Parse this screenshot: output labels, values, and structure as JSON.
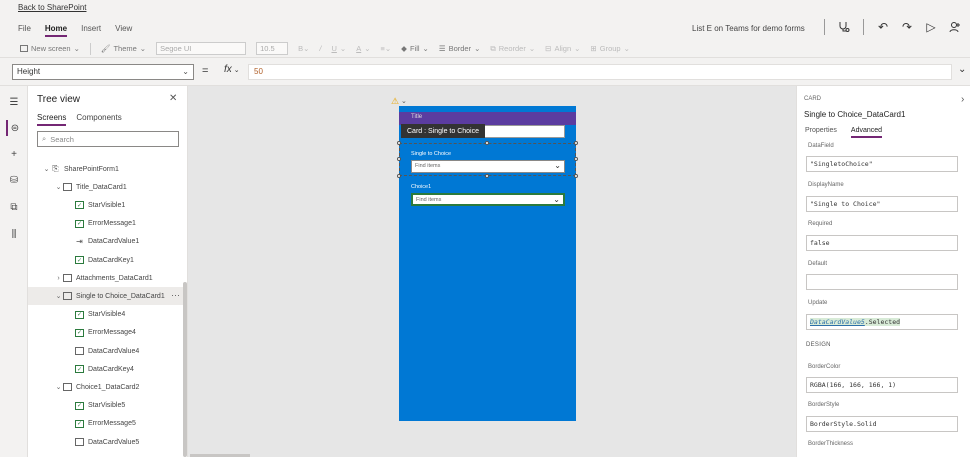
{
  "topbar": {
    "back_link": "Back to SharePoint",
    "menus": [
      "File",
      "Home",
      "Insert",
      "View"
    ],
    "active_menu": "Home",
    "app_title": "List E on Teams for demo forms"
  },
  "toolbar": {
    "new_screen": "New screen",
    "theme": "Theme",
    "font": "Segoe UI",
    "font_size": "10.5",
    "fill": "Fill",
    "border": "Border",
    "reorder": "Reorder",
    "align": "Align",
    "group": "Group"
  },
  "formula": {
    "property": "Height",
    "fx_label": "fx",
    "value": "50"
  },
  "treeview": {
    "title": "Tree view",
    "tabs": [
      "Screens",
      "Components"
    ],
    "search_placeholder": "Search",
    "items": [
      {
        "label": "SharePointForm1",
        "indent": 0,
        "icon": "form",
        "chev": "⌄"
      },
      {
        "label": "Title_DataCard1",
        "indent": 1,
        "icon": "box",
        "chev": "⌄"
      },
      {
        "label": "StarVisible1",
        "indent": 2,
        "icon": "chk",
        "chev": ""
      },
      {
        "label": "ErrorMessage1",
        "indent": 2,
        "icon": "chk",
        "chev": ""
      },
      {
        "label": "DataCardValue1",
        "indent": 2,
        "icon": "input",
        "chev": ""
      },
      {
        "label": "DataCardKey1",
        "indent": 2,
        "icon": "chk",
        "chev": ""
      },
      {
        "label": "Attachments_DataCard1",
        "indent": 1,
        "icon": "box",
        "chev": "›"
      },
      {
        "label": "Single to Choice_DataCard1",
        "indent": 1,
        "icon": "box",
        "chev": "⌄",
        "selected": true
      },
      {
        "label": "StarVisible4",
        "indent": 2,
        "icon": "chk",
        "chev": ""
      },
      {
        "label": "ErrorMessage4",
        "indent": 2,
        "icon": "chk",
        "chev": ""
      },
      {
        "label": "DataCardValue4",
        "indent": 2,
        "icon": "box",
        "chev": ""
      },
      {
        "label": "DataCardKey4",
        "indent": 2,
        "icon": "chk",
        "chev": ""
      },
      {
        "label": "Choice1_DataCard2",
        "indent": 1,
        "icon": "box",
        "chev": "⌄"
      },
      {
        "label": "StarVisible5",
        "indent": 2,
        "icon": "chk",
        "chev": ""
      },
      {
        "label": "ErrorMessage5",
        "indent": 2,
        "icon": "chk",
        "chev": ""
      },
      {
        "label": "DataCardValue5",
        "indent": 2,
        "icon": "box",
        "chev": ""
      }
    ],
    "more": "···"
  },
  "canvas": {
    "header_label": "Title",
    "tooltip": "Card : Single to Choice",
    "fields": [
      {
        "label": "Single to Choice",
        "placeholder": "Find items"
      },
      {
        "label": "Choice1",
        "placeholder": "Find items"
      }
    ]
  },
  "rightpanel": {
    "kind": "CARD",
    "title": "Single to Choice_DataCard1",
    "tabs": [
      "Properties",
      "Advanced"
    ],
    "active_tab": "Advanced",
    "datafield_label": "DataField",
    "datafield_value": "\"SingletoChoice\"",
    "displayname_label": "DisplayName",
    "displayname_value": "\"Single to Choice\"",
    "required_label": "Required",
    "required_value": "false",
    "default_label": "Default",
    "default_value": "",
    "update_label": "Update",
    "update_value_a": "DataCardValue5",
    "update_value_b": ".Selected",
    "design_label": "DESIGN",
    "bordercolor_label": "BorderColor",
    "bordercolor_value": "RGBA(166, 166, 166, 1)",
    "borderstyle_label": "BorderStyle",
    "borderstyle_value": "BorderStyle.Solid",
    "borderthickness_label": "BorderThickness"
  },
  "colors": {
    "accent": "#742774",
    "phone_bg": "#0078d4",
    "header_bar": "#5b3ca0",
    "focus_green": "#2b7a3d"
  }
}
